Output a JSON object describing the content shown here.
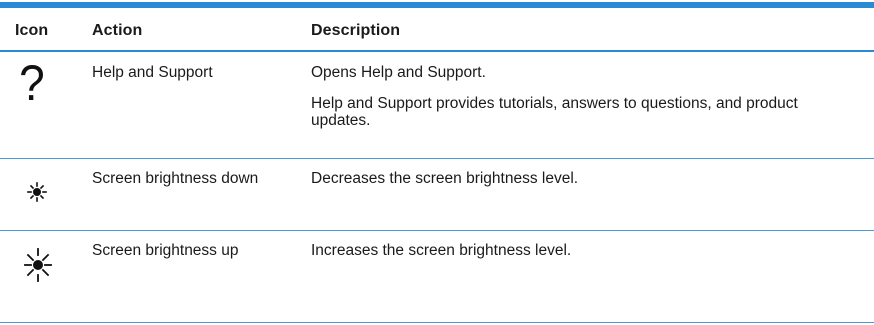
{
  "table": {
    "headers": {
      "icon": "Icon",
      "action": "Action",
      "description": "Description"
    },
    "rows": [
      {
        "icon": "question-mark-icon",
        "action": "Help and Support",
        "description": [
          "Opens Help and Support.",
          "Help and Support provides tutorials, answers to questions, and product updates."
        ]
      },
      {
        "icon": "brightness-down-icon",
        "action": "Screen brightness down",
        "description": [
          "Decreases the screen brightness level."
        ]
      },
      {
        "icon": "brightness-up-icon",
        "action": "Screen brightness up",
        "description": [
          "Increases the screen brightness level."
        ]
      }
    ]
  },
  "colors": {
    "rule": "#2a8ad4",
    "text": "#1a1a1a"
  }
}
